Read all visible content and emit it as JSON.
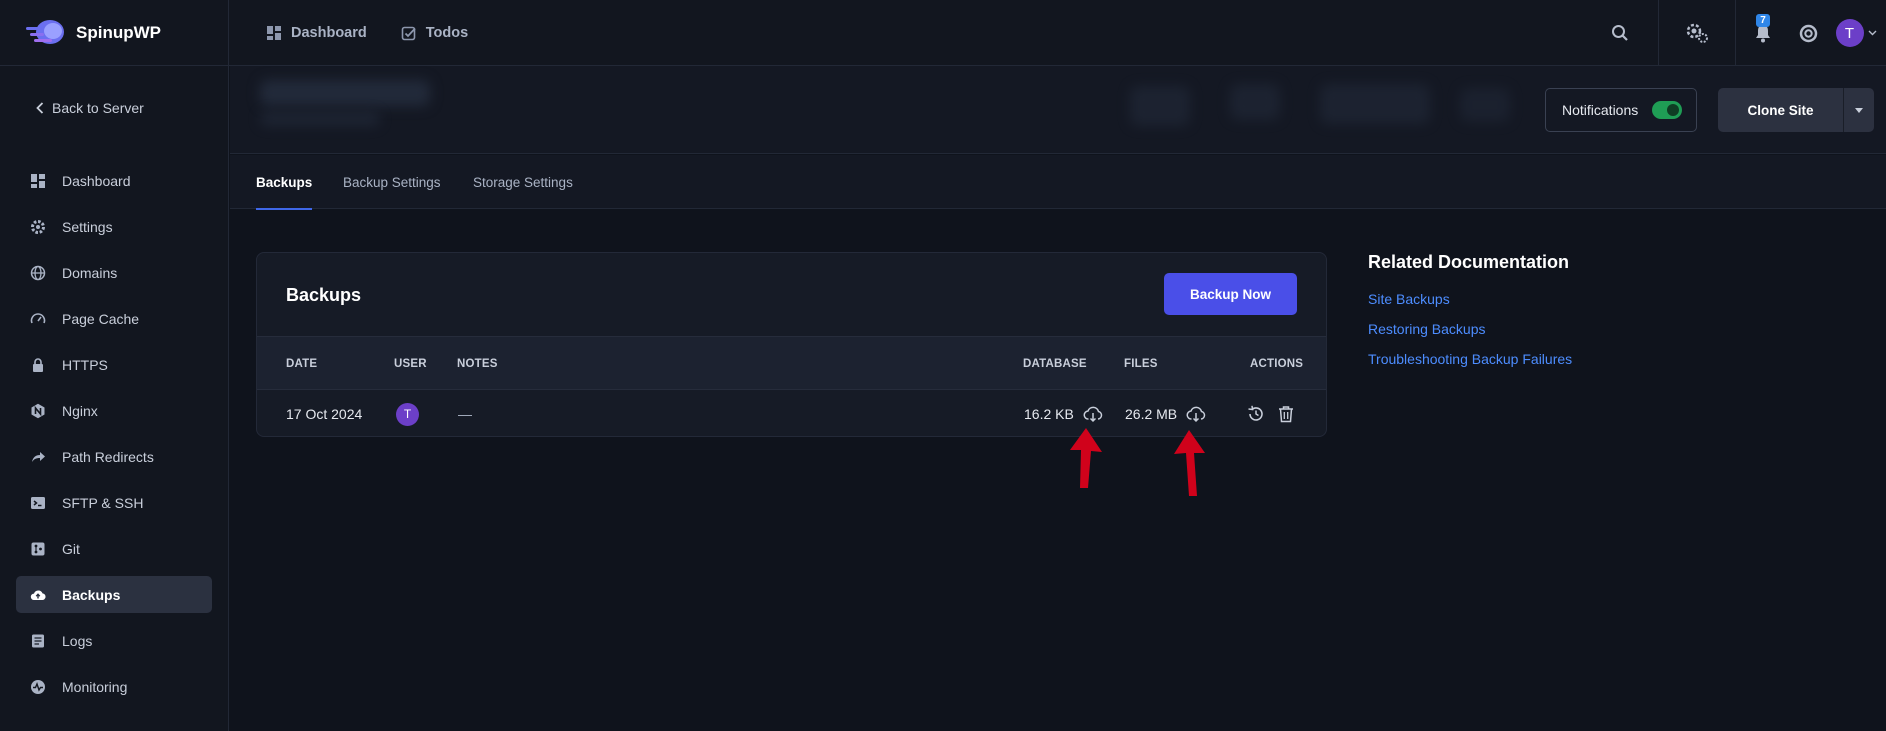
{
  "brand": {
    "name": "SpinupWP"
  },
  "topnav": {
    "dashboard": "Dashboard",
    "todos": "Todos"
  },
  "topbar": {
    "notifications_count": "7",
    "avatar_initial": "T"
  },
  "sidebar": {
    "back_label": "Back to Server",
    "items": [
      {
        "label": "Dashboard",
        "icon": "dashboard-icon"
      },
      {
        "label": "Settings",
        "icon": "gear-icon"
      },
      {
        "label": "Domains",
        "icon": "globe-icon"
      },
      {
        "label": "Page Cache",
        "icon": "gauge-icon"
      },
      {
        "label": "HTTPS",
        "icon": "lock-icon"
      },
      {
        "label": "Nginx",
        "icon": "nginx-icon"
      },
      {
        "label": "Path Redirects",
        "icon": "redirect-icon"
      },
      {
        "label": "SFTP & SSH",
        "icon": "terminal-icon"
      },
      {
        "label": "Git",
        "icon": "git-icon"
      },
      {
        "label": "Backups",
        "icon": "cloud-upload-icon",
        "active": true
      },
      {
        "label": "Logs",
        "icon": "logs-icon"
      },
      {
        "label": "Monitoring",
        "icon": "monitoring-icon"
      }
    ]
  },
  "siteheader": {
    "notifications_label": "Notifications",
    "notifications_enabled": true,
    "clone_label": "Clone Site"
  },
  "tabs": [
    {
      "label": "Backups",
      "active": true
    },
    {
      "label": "Backup Settings"
    },
    {
      "label": "Storage Settings"
    }
  ],
  "backups": {
    "title": "Backups",
    "backup_now_label": "Backup Now",
    "columns": {
      "date": "DATE",
      "user": "USER",
      "notes": "NOTES",
      "database": "DATABASE",
      "files": "FILES",
      "actions": "ACTIONS"
    },
    "rows": [
      {
        "date": "17 Oct 2024",
        "user_initial": "T",
        "notes": "—",
        "database": "16.2 KB",
        "files": "26.2 MB"
      }
    ]
  },
  "docs": {
    "title": "Related Documentation",
    "links": [
      "Site Backups",
      "Restoring Backups",
      "Troubleshooting Backup Failures"
    ]
  },
  "colors": {
    "accent": "#4a4fe8",
    "link": "#4d8dff",
    "avatar": "#6c3fc8",
    "toggle_on": "#1f9d55",
    "annotation_arrow": "#d0021b"
  }
}
